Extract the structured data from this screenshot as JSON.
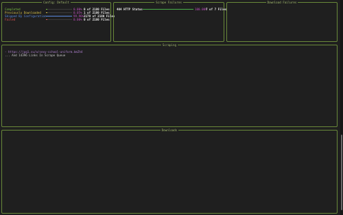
{
  "colors": {
    "border": "#6a8a3a",
    "title": "#a8c070",
    "completed": "#7bc043",
    "previously_downloaded": "#d9c34a",
    "skipped": "#5a8ae0",
    "failed": "#e05555",
    "percent": "#c050c0",
    "url": "#b080d0"
  },
  "panels": {
    "config": {
      "title": "Config: Default",
      "rows": [
        {
          "label": "Completed",
          "percent": "0.00%",
          "count": "0 of 2180 Files",
          "fill": 0.0,
          "color": "#7bc043"
        },
        {
          "label": "Previously Downloaded",
          "percent": "0.05%",
          "count": "1 of 2180 Files",
          "fill": 0.0005,
          "color": "#d9c34a"
        },
        {
          "label": "Skipped By Configuration",
          "percent": "99.96%",
          "count": "2179 of 2180 Files",
          "fill": 0.9996,
          "color": "#5a8ae0"
        },
        {
          "label": "Failed",
          "percent": "0.00%",
          "count": "0 of 2180 Files",
          "fill": 0.0,
          "color": "#e05555"
        }
      ]
    },
    "scrape_failures": {
      "title": "Scrape Failures",
      "rows": [
        {
          "label": "404 HTTP Status",
          "percent": "100.00%",
          "count": "7 of 7 Files",
          "fill": 1.0
        }
      ]
    },
    "download_failures": {
      "title": "Download Failures"
    },
    "scraping": {
      "title": "Scraping",
      "lines": [
        {
          "text": "- https://jpg1.su/a/sexy-school-uniform.bmZh4",
          "kind": "url"
        },
        {
          "text": "... And 14396 Links In Scrape Queue",
          "kind": "more"
        }
      ]
    },
    "downloads": {
      "title": "Downloads"
    }
  },
  "scrollbar": {
    "position": 0.63
  }
}
